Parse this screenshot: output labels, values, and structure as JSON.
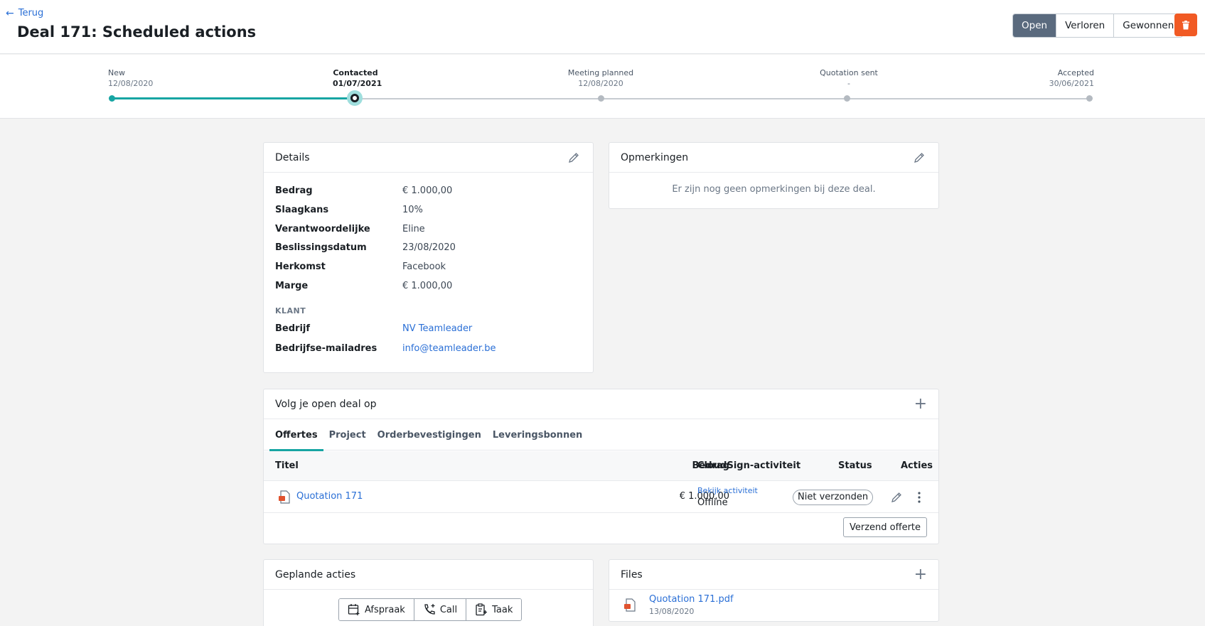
{
  "header": {
    "back_label": "Terug",
    "title": "Deal 171: Scheduled actions",
    "status_buttons": [
      {
        "label": "Open",
        "active": true
      },
      {
        "label": "Verloren",
        "active": false
      },
      {
        "label": "Gewonnen",
        "active": false
      }
    ],
    "delete_icon": "trash-icon"
  },
  "progress": {
    "stages": [
      {
        "name": "New",
        "date": "12/08/2020"
      },
      {
        "name": "Contacted",
        "date": "01/07/2021"
      },
      {
        "name": "Meeting planned",
        "date": "12/08/2020"
      },
      {
        "name": "Quotation sent",
        "date": "-"
      },
      {
        "name": "Accepted",
        "date": "30/06/2021"
      }
    ],
    "current_stage": "Contacted",
    "accent_color": "#17a5a3"
  },
  "details": {
    "title": "Details",
    "rows": [
      {
        "label": "Bedrag",
        "value": "€ 1.000,00"
      },
      {
        "label": "Slaagkans",
        "value": "10%"
      },
      {
        "label": "Verantwoordelijke",
        "value": "Eline"
      },
      {
        "label": "Beslissingsdatum",
        "value": "23/08/2020"
      },
      {
        "label": "Herkomst",
        "value": "Facebook"
      },
      {
        "label": "Marge",
        "value": "€ 1.000,00"
      }
    ],
    "klant_heading": "KLANT",
    "klant_rows": [
      {
        "label": "Bedrijf",
        "value": "NV Teamleader"
      },
      {
        "label": "Bedrijfse-mailadres",
        "value": "info@teamleader.be"
      }
    ]
  },
  "remarks": {
    "title": "Opmerkingen",
    "empty_text": "Er zijn nog geen opmerkingen bij deze deal."
  },
  "followup": {
    "title": "Volg je open deal op",
    "tabs": [
      "Offertes",
      "Project",
      "Orderbevestigingen",
      "Leveringsbonnen"
    ],
    "active_tab": "Offertes",
    "columns": {
      "titel": "Titel",
      "bedrag": "Bedrag",
      "cloudsign": "CloudSign-activiteit",
      "status": "Status",
      "acties": "Acties"
    },
    "rows": [
      {
        "title": "Quotation 171",
        "amount": "€ 1.000,00",
        "activity_link": "Bekijk activiteit",
        "activity_state": "Offline",
        "status": "Niet verzonden"
      }
    ],
    "send_button": "Verzend offerte"
  },
  "planned": {
    "title": "Geplande acties",
    "buttons": [
      {
        "label": "Afspraak",
        "icon": "calendar-plus-icon"
      },
      {
        "label": "Call",
        "icon": "phone-plus-icon"
      },
      {
        "label": "Taak",
        "icon": "clipboard-plus-icon"
      }
    ]
  },
  "files": {
    "title": "Files",
    "items": [
      {
        "name": "Quotation 171.pdf",
        "date": "13/08/2020"
      }
    ]
  }
}
